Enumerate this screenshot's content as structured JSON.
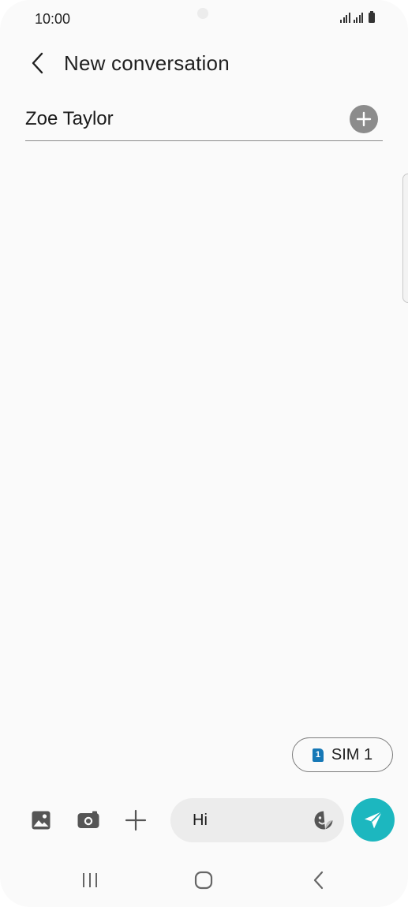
{
  "status_bar": {
    "time": "10:00",
    "icons": [
      "signal-sim1-icon",
      "signal-sim2-icon",
      "battery-icon"
    ]
  },
  "header": {
    "back_icon": "chevron-left-icon",
    "title": "New conversation"
  },
  "recipient": {
    "value": "Zoe Taylor",
    "add_icon": "plus-circle-icon"
  },
  "sim": {
    "badge": "1",
    "label": "SIM 1",
    "badge_color": "#1678b6"
  },
  "compose": {
    "tools": [
      "gallery-icon",
      "camera-icon",
      "plus-icon"
    ],
    "message_value": "Hi",
    "sticker_icon": "sticker-icon",
    "send_icon": "send-icon",
    "send_color": "#1cb7bf"
  },
  "navigation": {
    "items": [
      "recent-apps-icon",
      "home-icon",
      "back-icon"
    ]
  }
}
